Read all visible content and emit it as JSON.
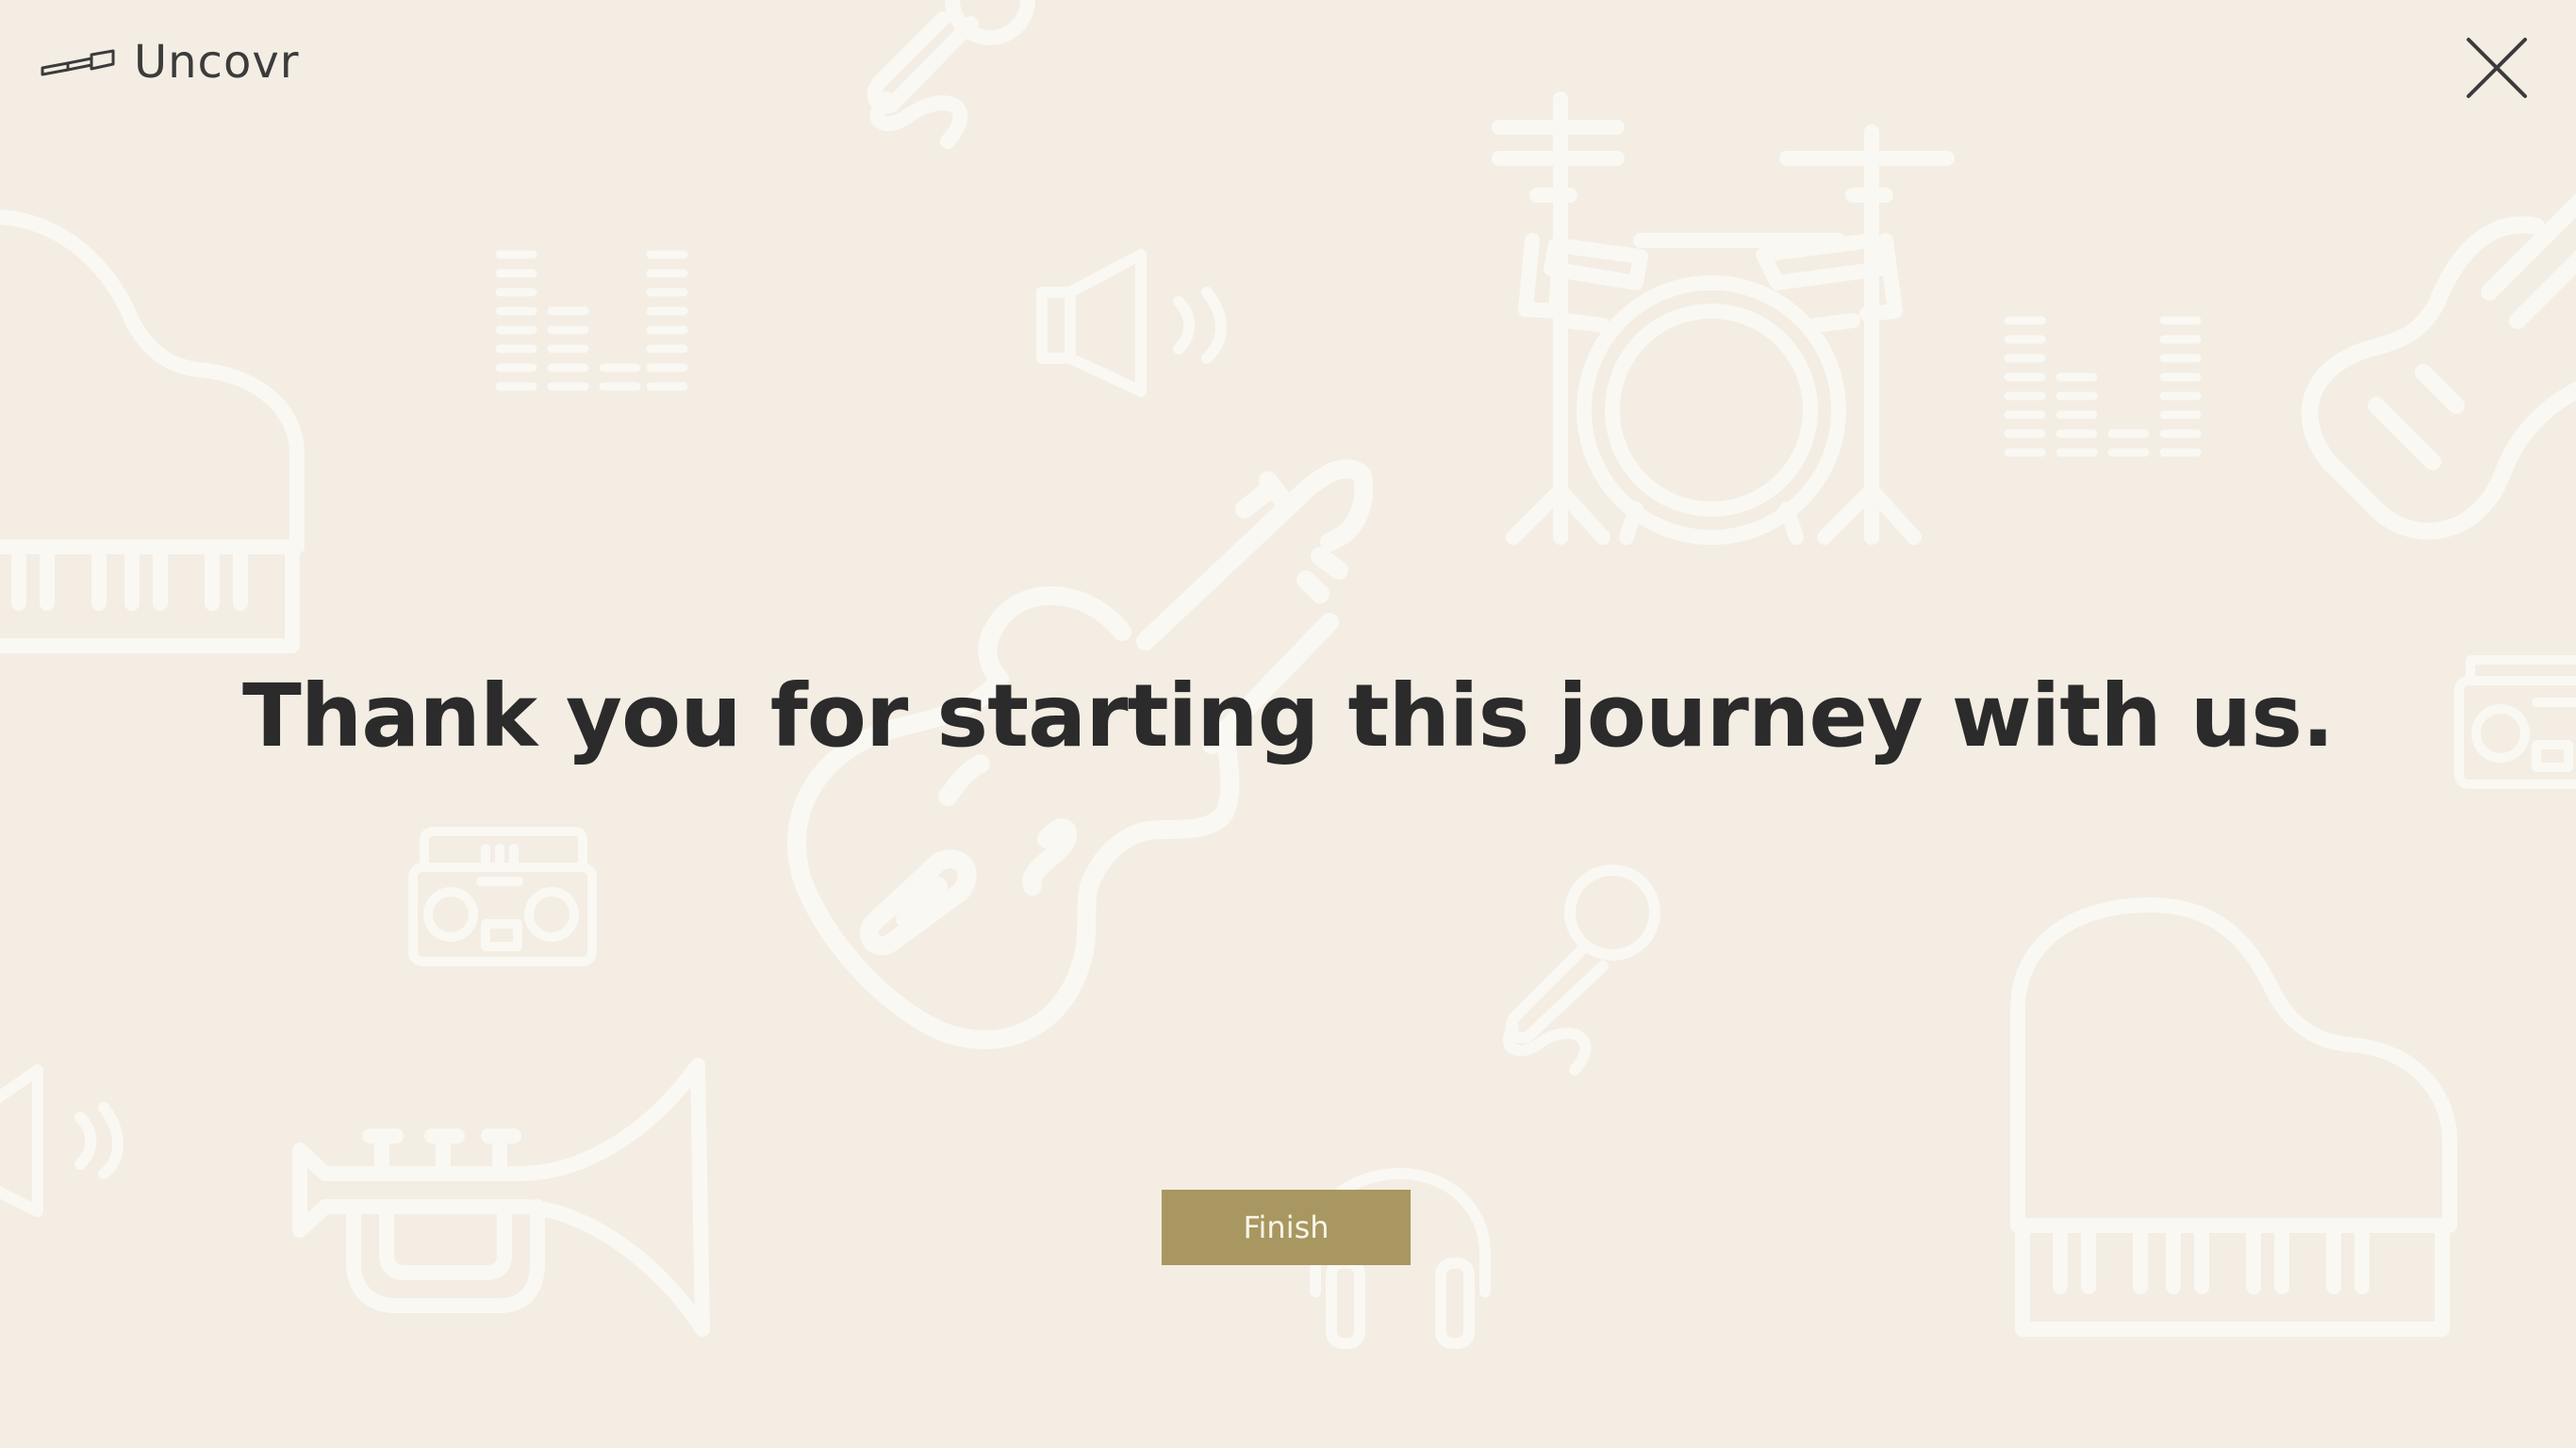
{
  "app": {
    "name": "Uncovr",
    "logo_icon": "telescope-icon"
  },
  "header": {
    "close_icon": "close-icon"
  },
  "main": {
    "headline": "Thank you for starting this journey with us.",
    "finish_label": "Finish"
  },
  "background": {
    "icons": [
      "piano-icon",
      "equalizer-icon",
      "microphone-icon",
      "speaker-icon",
      "drum-kit-icon",
      "guitar-icon",
      "violin-icon",
      "boombox-icon",
      "trumpet-icon",
      "headphones-icon"
    ]
  },
  "colors": {
    "background": "#f3ede3",
    "accent": "#a89760",
    "text": "#2b2b2b",
    "watermark": "#faf8f4"
  }
}
